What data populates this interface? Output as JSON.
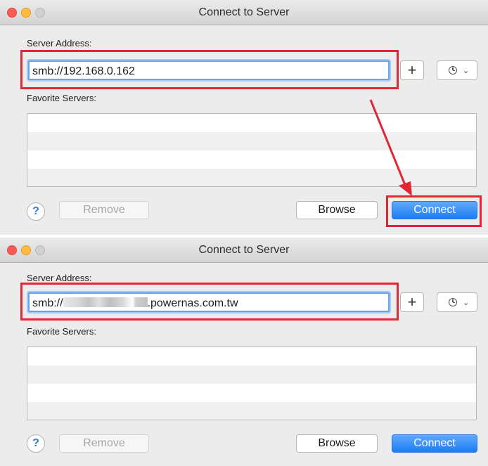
{
  "window_title": "Connect to Server",
  "server_address_label": "Server Address:",
  "favorite_servers_label": "Favorite Servers:",
  "buttons": {
    "plus": "+",
    "help": "?",
    "remove": "Remove",
    "browse": "Browse",
    "connect": "Connect"
  },
  "icons": [
    "clock-icon",
    "chevron-down-icon",
    "plus-icon",
    "help-icon"
  ],
  "window1": {
    "address_value": "smb://192.168.0.162"
  },
  "window2": {
    "address_prefix": "smb://",
    "address_suffix": ".powernas.com.tw"
  },
  "colors": {
    "annotation_red": "#e32635",
    "connect_blue": "#1b7cf4",
    "focus_ring": "#6aa3e6"
  }
}
